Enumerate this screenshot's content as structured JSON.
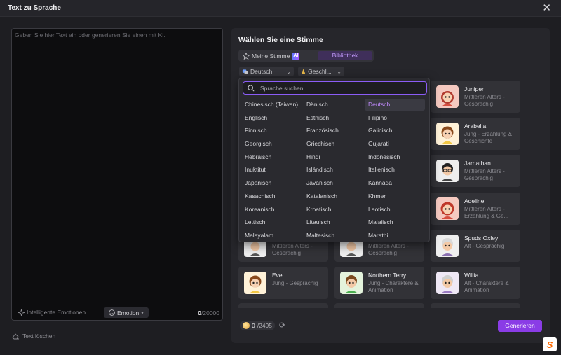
{
  "window": {
    "title": "Text zu Sprache",
    "close_icon": "close-icon"
  },
  "editor": {
    "placeholder": "Geben Sie hier Text ein oder generieren Sie einen mit KI.",
    "smart_emotions_label": "Intelligente Emotionen",
    "emotion_label": "Emotion",
    "char_count": "0",
    "char_limit": "/20000"
  },
  "clear_text_label": "Text löschen",
  "voice_panel": {
    "title": "Wählen Sie eine Stimme",
    "tab_mine": "Meine Stimme",
    "ai_badge": "AI",
    "tab_library": "Bibliothek",
    "filter_language": "Deutsch",
    "filter_gender": "Geschl...",
    "search_placeholder": "Sprache suchen",
    "languages": [
      "Chinesisch (Taiwan)",
      "Dänisch",
      "Deutsch",
      "Englisch",
      "Estnisch",
      "Filipino",
      "Finnisch",
      "Französisch",
      "Galicisch",
      "Georgisch",
      "Griechisch",
      "Gujarati",
      "Hebräisch",
      "Hindi",
      "Indonesisch",
      "Inuktitut",
      "Isländisch",
      "Italienisch",
      "Japanisch",
      "Javanisch",
      "Kannada",
      "Kasachisch",
      "Katalanisch",
      "Khmer",
      "Koreanisch",
      "Kroatisch",
      "Laotisch",
      "Lettisch",
      "Litauisch",
      "Malaiisch",
      "Malayalam",
      "Maltesisch",
      "Marathi"
    ],
    "selected_language": "Deutsch",
    "voices": [
      {
        "name": "Juniper",
        "desc": "Mittleren Alters - Gesprächig"
      },
      {
        "name": "Arabella",
        "desc": "Jung - Erzählung & Geschichte"
      },
      {
        "name": "Jarnathan",
        "desc": "Mittleren Alters - Gesprächig"
      },
      {
        "name": "Adeline",
        "desc": "Mittleren Alters - Erzählung & Ge..."
      },
      {
        "name": "",
        "desc": "Mittleren Alters - Gesprächig"
      },
      {
        "name": "",
        "desc": "Mittleren Alters - Gesprächig"
      },
      {
        "name": "Spuds Oxley",
        "desc": "Alt - Gesprächig"
      },
      {
        "name": "Eve",
        "desc": "Jung - Gesprächig"
      },
      {
        "name": "Northern Terry",
        "desc": "Jung - Charaktere & Animation"
      },
      {
        "name": "Willia",
        "desc": "Alt - Charaktere & Animation"
      }
    ],
    "credits_used": "0",
    "credits_total": "/2495",
    "generate_label": "Generieren"
  },
  "colors": {
    "accent": "#8a3ce6",
    "selected_text": "#c28bff",
    "panel_bg": "#26262b"
  }
}
